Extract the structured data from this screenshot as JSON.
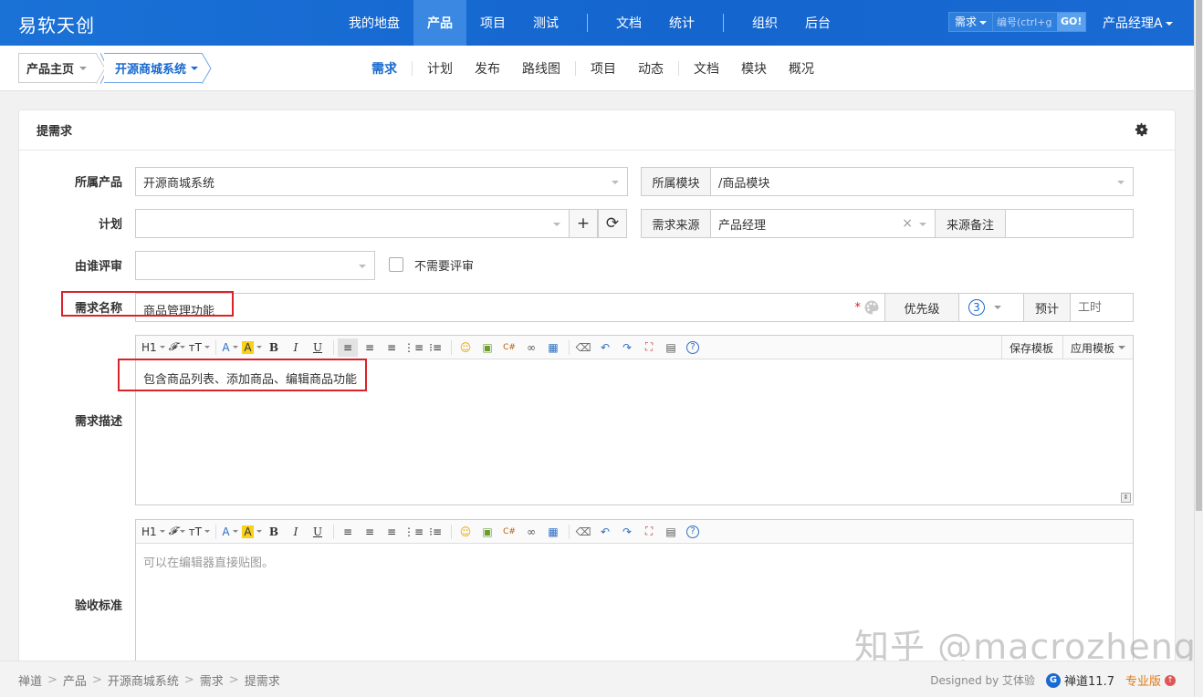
{
  "header": {
    "brand": "易软天创",
    "nav": [
      {
        "label": "我的地盘",
        "active": false
      },
      {
        "label": "产品",
        "active": true
      },
      {
        "label": "项目",
        "active": false
      },
      {
        "label": "测试",
        "active": false
      },
      {
        "label": "文档",
        "active": false
      },
      {
        "label": "统计",
        "active": false
      },
      {
        "label": "组织",
        "active": false
      },
      {
        "label": "后台",
        "active": false
      }
    ],
    "search": {
      "type": "需求",
      "placeholder": "编号(ctrl+g)",
      "go": "GO!"
    },
    "user": "产品经理A"
  },
  "subheader": {
    "crumb_home": "产品主页",
    "crumb_product": "开源商城系统",
    "nav": [
      {
        "label": "需求",
        "active": true
      },
      {
        "label": "计划"
      },
      {
        "label": "发布"
      },
      {
        "label": "路线图"
      },
      {
        "label": "项目"
      },
      {
        "label": "动态"
      },
      {
        "label": "文档"
      },
      {
        "label": "模块"
      },
      {
        "label": "概况"
      }
    ]
  },
  "form": {
    "title": "提需求",
    "product_label": "所属产品",
    "product_value": "开源商城系统",
    "module_label": "所属模块",
    "module_value": "/商品模块",
    "plan_label": "计划",
    "plan_add": "+",
    "plan_refresh": "⟳",
    "source_label": "需求来源",
    "source_value": "产品经理",
    "source_clear": "×",
    "source_note_label": "来源备注",
    "reviewer_label": "由谁评审",
    "no_review_label": "不需要评审",
    "name_label": "需求名称",
    "name_value": "商品管理功能",
    "required_mark": "*",
    "priority_label": "优先级",
    "priority_value": "3",
    "estimate_label": "预计",
    "estimate_placeholder": "工时",
    "desc_label": "需求描述",
    "desc_content": "包含商品列表、添加商品、编辑商品功能",
    "save_template": "保存模板",
    "apply_template": "应用模板",
    "verify_label": "验收标准",
    "verify_placeholder": "可以在编辑器直接贴图。"
  },
  "toolbar": {
    "heading": "H1",
    "font": "𝓕",
    "size": "ᴛT",
    "color": "A",
    "bg": "A",
    "bold": "B",
    "italic": "I",
    "underline": "U",
    "help": "?"
  },
  "footer": {
    "crumbs": [
      "禅道",
      "产品",
      "开源商城系统",
      "需求",
      "提需求"
    ],
    "designed_by": "Designed by 艾体验",
    "version": "禅道11.7",
    "edition": "专业版"
  },
  "watermark": "知乎 @macrozheng",
  "colors": {
    "header": "#1465ce",
    "active_nav": "#3a88e2",
    "accent": "#1a6acf",
    "highlight": "#d9222a",
    "edition": "#e07a10"
  }
}
